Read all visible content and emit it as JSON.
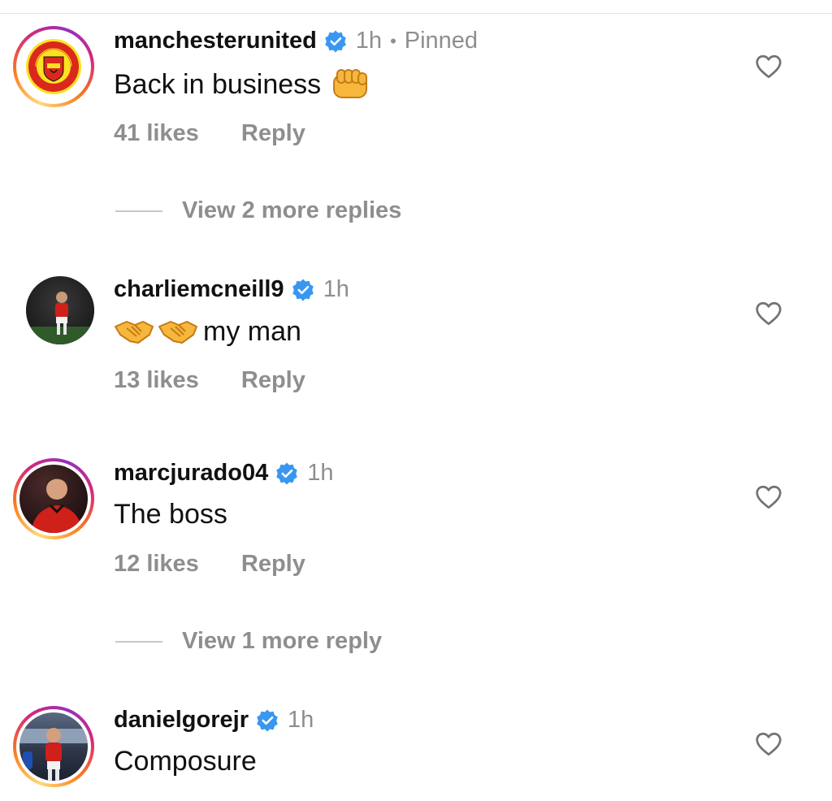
{
  "comments": [
    {
      "username": "manchesterunited",
      "time": "1h",
      "separator": "•",
      "pinned_label": "Pinned",
      "text": "Back in business",
      "emoji": "fist-bump",
      "likes": "41 likes",
      "reply_label": "Reply",
      "view_replies": "View 2 more replies",
      "avatar": "club-crest",
      "has_story_ring": true
    },
    {
      "username": "charliemcneill9",
      "time": "1h",
      "text": "my man",
      "emoji": "handshake-handshake",
      "likes": "13 likes",
      "reply_label": "Reply",
      "avatar": "player-photo",
      "has_story_ring": false
    },
    {
      "username": "marcjurado04",
      "time": "1h",
      "text": "The boss",
      "likes": "12 likes",
      "reply_label": "Reply",
      "view_replies": "View 1 more reply",
      "avatar": "player-photo",
      "has_story_ring": true
    },
    {
      "username": "danielgorejr",
      "time": "1h",
      "text": "Composure",
      "avatar": "player-photo",
      "has_story_ring": true
    }
  ],
  "colors": {
    "verified": "#3897f0",
    "secondary_text": "#8e8e8e",
    "club_red": "#da291c",
    "club_gold": "#fbe122"
  }
}
